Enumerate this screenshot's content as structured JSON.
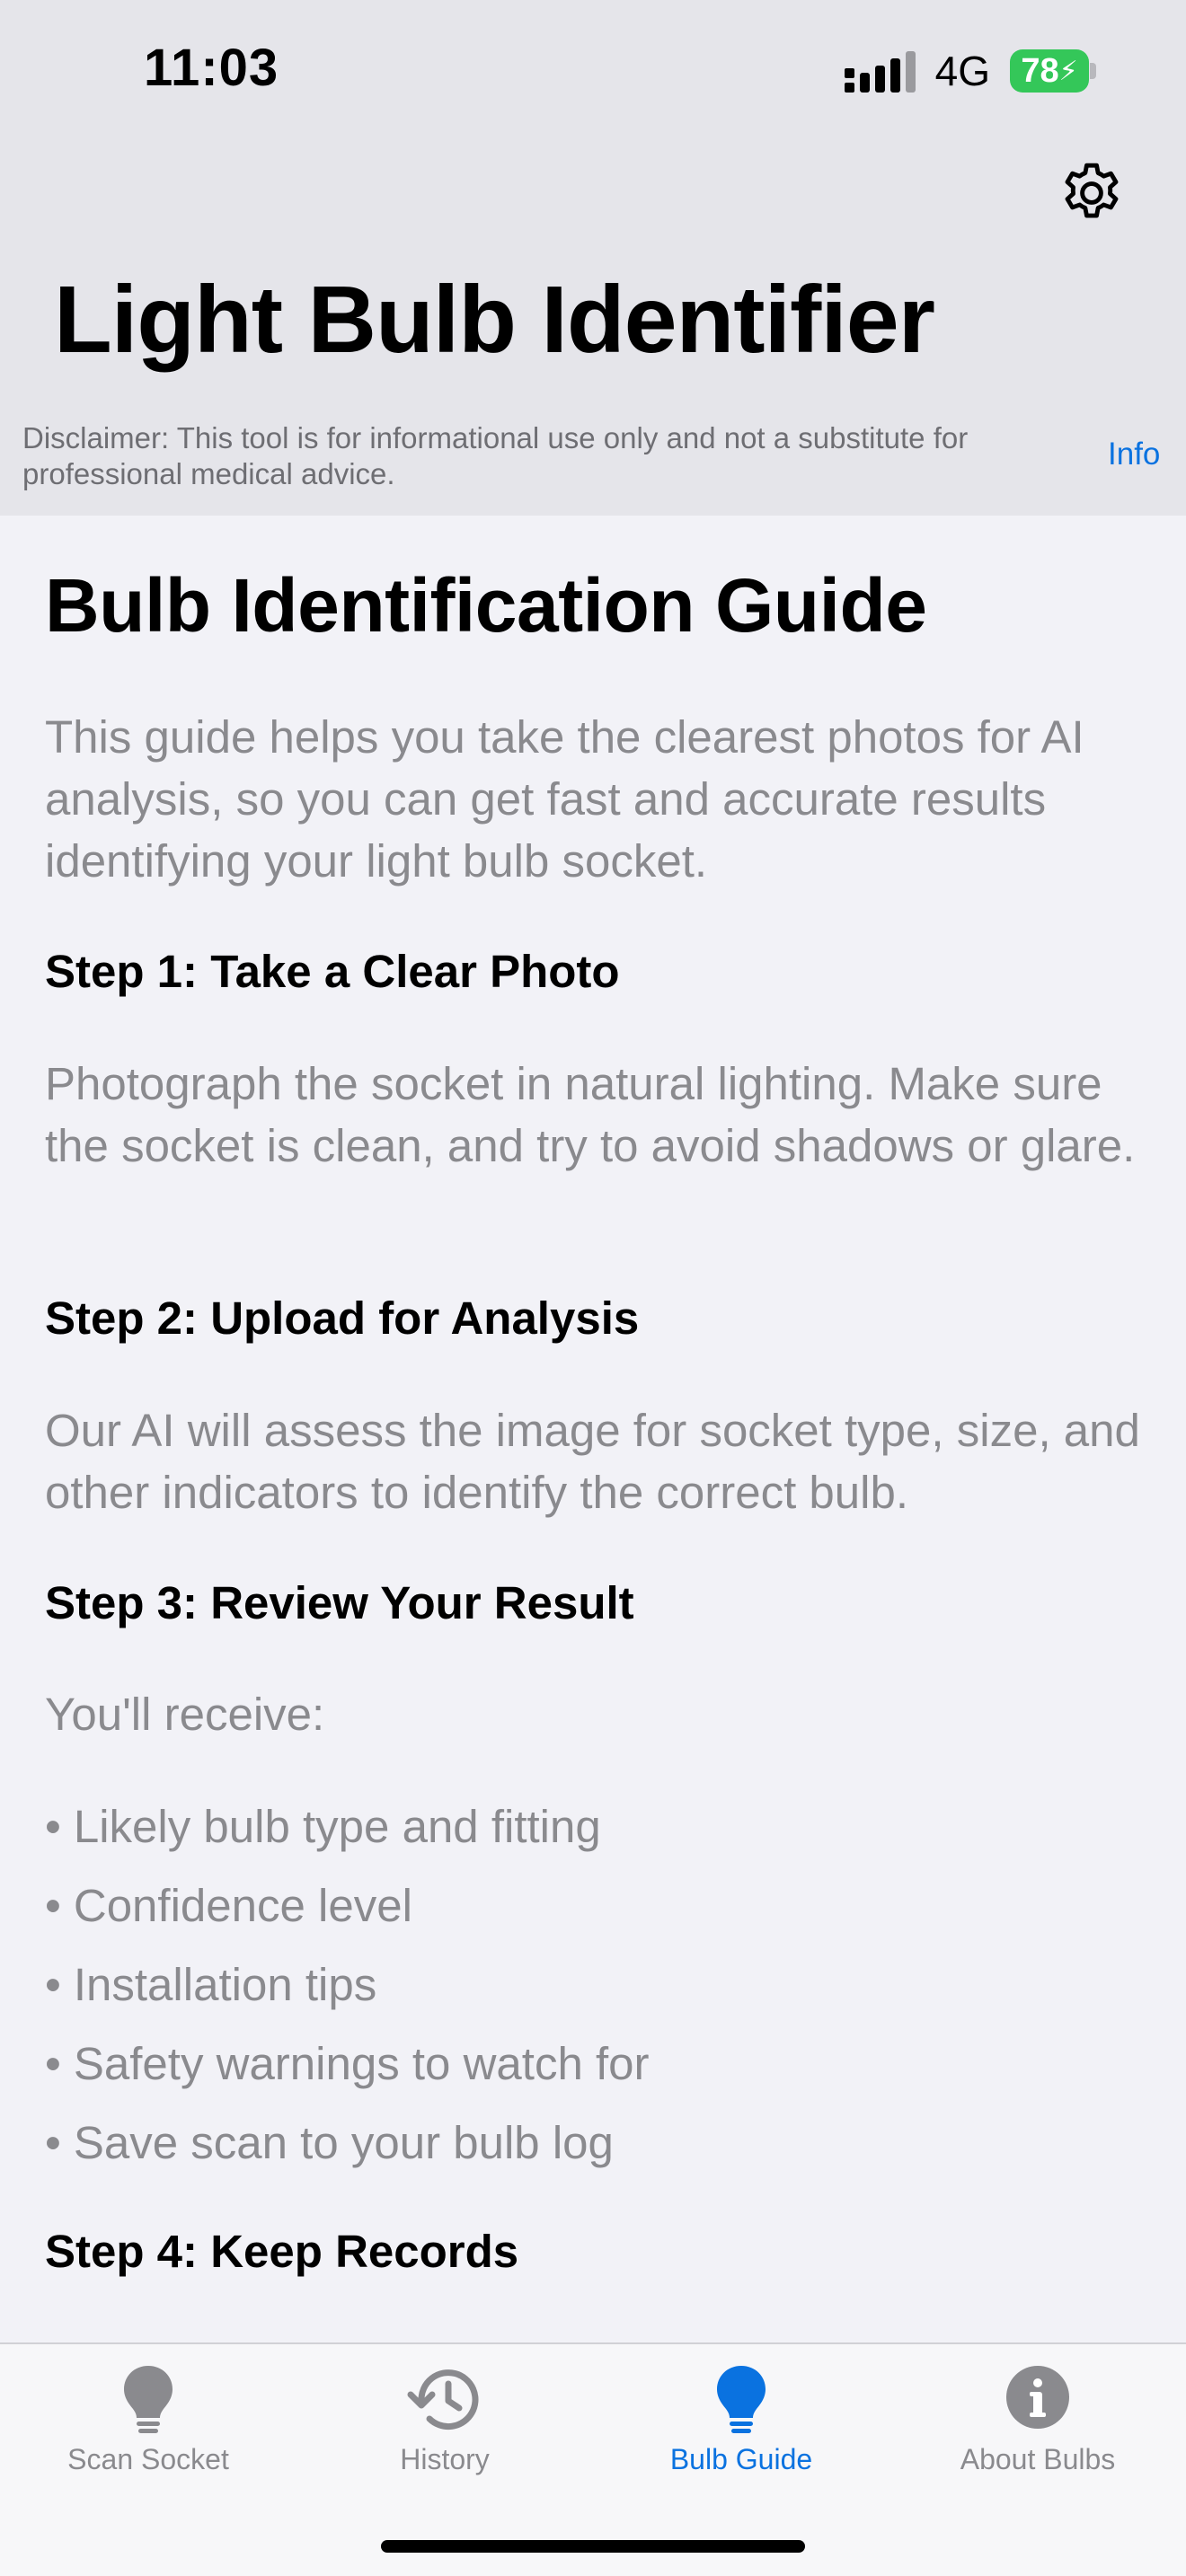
{
  "status_bar": {
    "time": "11:03",
    "network": "4G",
    "battery": "78"
  },
  "header": {
    "title": "Light Bulb Identifier",
    "disclaimer": "Disclaimer: This tool is for informational use only and not a substitute for professional medical advice.",
    "info_label": "Info",
    "settings_icon": "gear-icon"
  },
  "guide": {
    "title": "Bulb Identification Guide",
    "intro": "This guide helps you take the clearest photos for AI analysis, so you can get fast and accurate results identifying your light bulb socket.",
    "step1_title": "Step 1: Take a Clear Photo",
    "step1_text": "Photograph the socket in natural lighting. Make sure the socket is clean, and try to avoid shadows or glare.",
    "step2_title": "Step 2: Upload for Analysis",
    "step2_text": "Our AI will assess the image for socket type, size, and other indicators to identify the correct bulb.",
    "step3_title": "Step 3: Review Your Result",
    "step3_text": "You'll receive:",
    "bullets": [
      "Likely bulb type and fitting",
      "Confidence level",
      "Installation tips",
      "Safety warnings to watch for",
      "Save scan to your bulb log"
    ],
    "step4_title": "Step 4: Keep Records"
  },
  "tabs": [
    {
      "label": "Scan Socket",
      "icon": "lightbulb-icon",
      "active": false
    },
    {
      "label": "History",
      "icon": "history-clock-icon",
      "active": false
    },
    {
      "label": "Bulb Guide",
      "icon": "lightbulb-filled-icon",
      "active": true
    },
    {
      "label": "About Bulbs",
      "icon": "info-circle-icon",
      "active": false
    }
  ],
  "colors": {
    "accent": "#0a72e0",
    "battery": "#34c759",
    "secondary_text": "#8a8a8e"
  }
}
